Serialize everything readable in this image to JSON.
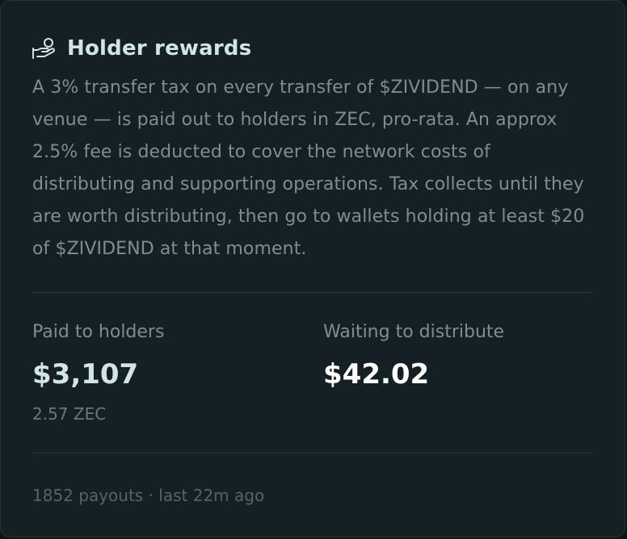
{
  "card": {
    "title": "Holder rewards",
    "icon": "hand-coin-icon",
    "description": "A 3% transfer tax on every transfer of $ZIVIDEND — on any venue — is paid out to holders in ZEC, pro-rata. An approx 2.5% fee is deducted to cover the network costs of distributing and supporting operations. Tax collects until they are worth distributing, then go to wallets holding at least $20 of $ZIVIDEND at that moment."
  },
  "stats": {
    "paid": {
      "label": "Paid to holders",
      "value": "$3,107",
      "sub": "2.57 ZEC",
      "color": "#cfe5e6"
    },
    "waiting": {
      "label": "Waiting to distribute",
      "value": "$42.02",
      "color": "#ffffff"
    }
  },
  "footer": {
    "text": "1852 payouts · last 22m ago"
  },
  "colors": {
    "background": "#0d1518",
    "card": "#152025",
    "accent": "#cfe5e6",
    "muted": "#7f8d92"
  }
}
